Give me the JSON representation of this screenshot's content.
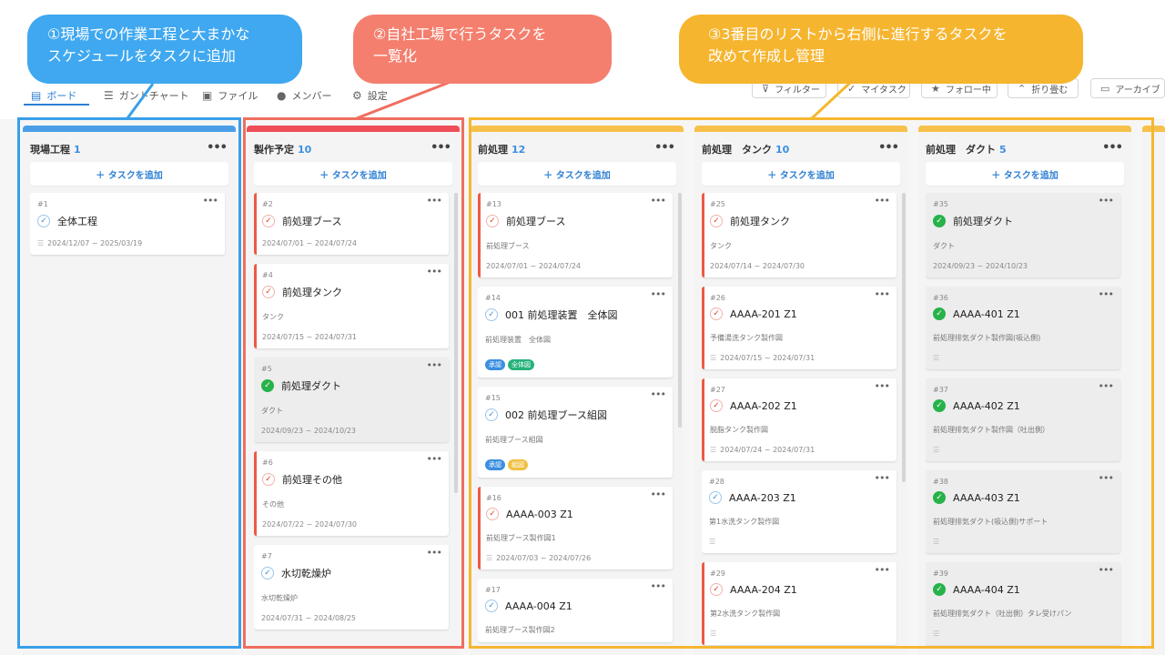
{
  "toolbar": {
    "tabs": [
      {
        "icon": "board-icon",
        "label": "ボード",
        "active": true
      },
      {
        "icon": "gantt-icon",
        "label": "ガントチャート"
      },
      {
        "icon": "file-icon",
        "label": "ファイル"
      },
      {
        "icon": "member-icon",
        "label": "メンバー"
      },
      {
        "icon": "gear-icon",
        "label": "設定"
      }
    ],
    "buttons": [
      {
        "icon": "filter-icon",
        "label": "フィルター"
      },
      {
        "icon": "check-icon",
        "label": "マイタスク"
      },
      {
        "icon": "star-icon",
        "label": "フォロー中"
      },
      {
        "icon": "chevron-up-icon",
        "label": "折り畳む"
      },
      {
        "icon": "folder-icon",
        "label": "アーカイブ"
      }
    ]
  },
  "add_task_label": "＋ タスクを追加",
  "columns": [
    {
      "title": "現場工程",
      "count": "1",
      "bar_color": "#4a9fe8",
      "cards": [
        {
          "num": "#1",
          "check": "blue",
          "title": "全体工程",
          "date": "2024/12/07 ~ 2025/03/19"
        }
      ]
    },
    {
      "title": "製作予定",
      "count": "10",
      "bar_color": "#ef4d57",
      "cards": [
        {
          "num": "#2",
          "check": "red",
          "title": "前処理ブース",
          "date": "2024/07/01 ~ 2024/07/24",
          "red": true
        },
        {
          "num": "#4",
          "check": "red",
          "title": "前処理タンク",
          "desc": "タンク",
          "date": "2024/07/15 ~ 2024/07/31",
          "red": true
        },
        {
          "num": "#5",
          "check": "green",
          "title": "前処理ダクト",
          "desc": "ダクト",
          "date": "2024/09/23 ~ 2024/10/23",
          "done": true
        },
        {
          "num": "#6",
          "check": "red",
          "title": "前処理その他",
          "desc": "その他",
          "date": "2024/07/22 ~ 2024/07/30",
          "red": true
        },
        {
          "num": "#7",
          "check": "blue",
          "title": "水切乾燥炉",
          "desc": "水切乾燥炉",
          "date": "2024/07/31 ~ 2024/08/25"
        }
      ]
    },
    {
      "title": "前処理",
      "count": "12",
      "bar_color": "#f6c04a",
      "cards": [
        {
          "num": "#13",
          "check": "red",
          "title": "前処理ブース",
          "desc": "前処理ブース",
          "date": "2024/07/01 ~ 2024/07/24",
          "red": true
        },
        {
          "num": "#14",
          "check": "blue",
          "title": "001 前処理装置　全体図",
          "desc": "前処理装置　全体図",
          "tags": [
            {
              "text": "承認",
              "color": "#3b8fe0"
            },
            {
              "text": "全体図",
              "color": "#27b27a"
            }
          ]
        },
        {
          "num": "#15",
          "check": "blue",
          "title": "002 前処理ブース組図",
          "desc": "前処理ブース組図",
          "tags": [
            {
              "text": "承認",
              "color": "#3b8fe0"
            },
            {
              "text": "組図",
              "color": "#f0c040"
            }
          ]
        },
        {
          "num": "#16",
          "check": "red",
          "title": "AAAA-003 Z1",
          "desc": "前処理ブース製作図1",
          "date": "2024/07/03 ~ 2024/07/26",
          "red": true,
          "date_icon": true
        },
        {
          "num": "#17",
          "check": "blue",
          "title": "AAAA-004 Z1",
          "desc": "前処理ブース製作図2"
        }
      ]
    },
    {
      "title": "前処理　タンク",
      "count": "10",
      "bar_color": "#f6c04a",
      "cards": [
        {
          "num": "#25",
          "check": "red",
          "title": "前処理タンク",
          "desc": "タンク",
          "date": "2024/07/14 ~ 2024/07/30",
          "red": true
        },
        {
          "num": "#26",
          "check": "red",
          "title": "AAAA-201 Z1",
          "desc": "予備湯洗タンク製作図",
          "date": "2024/07/15 ~ 2024/07/31",
          "red": true,
          "date_icon": true
        },
        {
          "num": "#27",
          "check": "red",
          "title": "AAAA-202 Z1",
          "desc": "脱脂タンク製作図",
          "date": "2024/07/24 ~ 2024/07/31",
          "red": true,
          "date_icon": true
        },
        {
          "num": "#28",
          "check": "blue",
          "title": "AAAA-203 Z1",
          "desc": "第1水洗タンク製作図",
          "lines": true
        },
        {
          "num": "#29",
          "check": "red",
          "title": "AAAA-204 Z1",
          "desc": "第2水洗タンク製作図",
          "lines": true,
          "red": true
        }
      ]
    },
    {
      "title": "前処理　ダクト",
      "count": "5",
      "bar_color": "#f6c04a",
      "cards": [
        {
          "num": "#35",
          "check": "green",
          "title": "前処理ダクト",
          "desc": "ダクト",
          "date": "2024/09/23 ~ 2024/10/23",
          "done": true
        },
        {
          "num": "#36",
          "check": "green",
          "title": "AAAA-401 Z1",
          "desc": "前処理排気ダクト製作図(吸込側)",
          "lines": true,
          "done": true
        },
        {
          "num": "#37",
          "check": "green",
          "title": "AAAA-402 Z1",
          "desc": "前処理排気ダクト製作図（吐出側）",
          "lines": true,
          "done": true
        },
        {
          "num": "#38",
          "check": "green",
          "title": "AAAA-403 Z1",
          "desc": "前処理排気ダクト(吸込側)サポート",
          "lines": true,
          "done": true
        },
        {
          "num": "#39",
          "check": "green",
          "title": "AAAA-404 Z1",
          "desc": "前処理排気ダクト（吐出側）タレ受けパン",
          "lines": true,
          "done": true
        }
      ]
    }
  ],
  "annotations": [
    {
      "text": "①現場での作業工程と大まかな\nスケジュールをタスクに追加",
      "color": "#3fa8f0"
    },
    {
      "text": "②自社工場で行うタスクを\n一覧化",
      "color": "#f47f6e"
    },
    {
      "text": "③3番目のリストから右側に進行するタスクを\n改めて作成し管理",
      "color": "#f6b52f"
    }
  ]
}
